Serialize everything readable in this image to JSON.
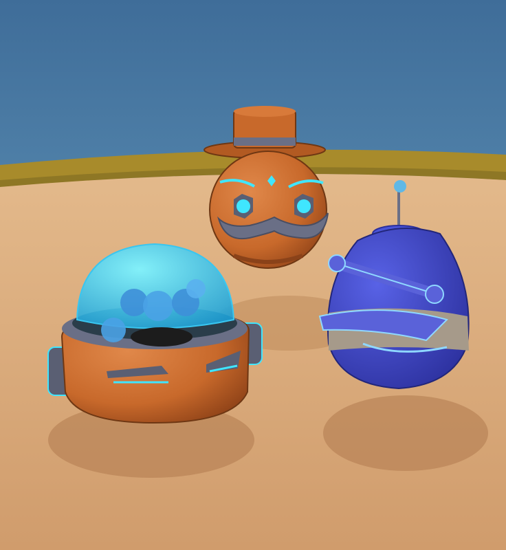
{
  "scene": {
    "description_colors": {
      "sky": "#3f6d99",
      "wall": "#a88b2b",
      "ground": "#d6a679",
      "orange_body": "#c8692b",
      "glow": "#3fe6ff",
      "blue_body": "#3b46c9",
      "metal": "#5a5f73"
    }
  }
}
